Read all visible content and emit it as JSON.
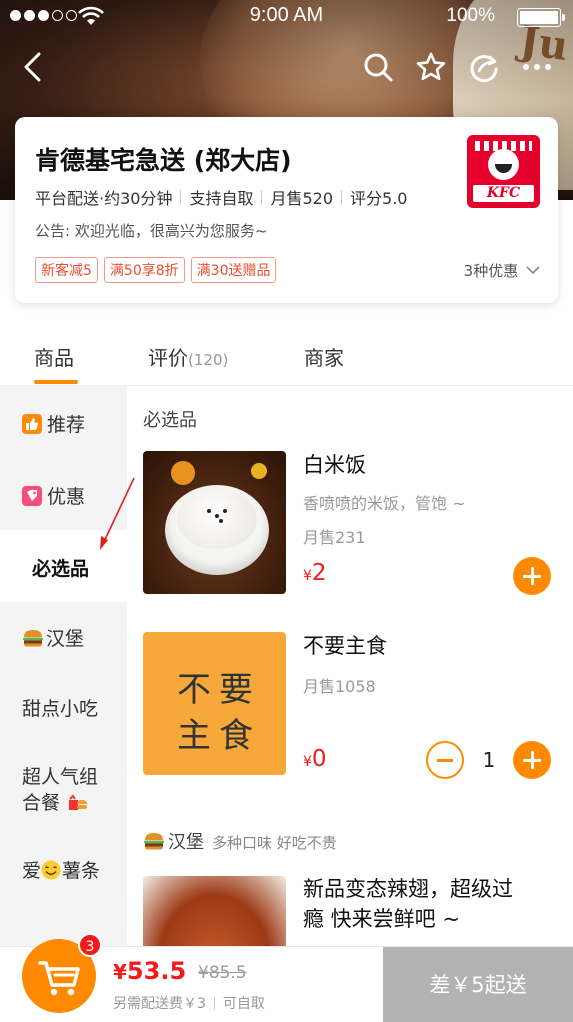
{
  "status_bar": {
    "time": "9:00 AM",
    "battery": "100%"
  },
  "nav": {
    "icons": [
      "back-icon",
      "search-icon",
      "star-icon",
      "share-icon",
      "more-icon"
    ]
  },
  "shop": {
    "name": "肯德基宅急送 (郑大店)",
    "meta": [
      "平台配送·约30分钟",
      "支持自取",
      "月售520",
      "评分5.0"
    ],
    "notice": "公告: 欢迎光临，很高兴为您服务~",
    "promos": [
      "新客减5",
      "满50享8折",
      "满30送赠品"
    ],
    "promo_more": "3种优惠",
    "logo_text": "KFC"
  },
  "tabs": [
    {
      "label": "商品",
      "count": ""
    },
    {
      "label": "评价",
      "count": "(120)"
    },
    {
      "label": "商家",
      "count": ""
    }
  ],
  "categories": [
    {
      "label": "推荐"
    },
    {
      "label": "优惠"
    },
    {
      "label": "必选品"
    },
    {
      "label": "汉堡"
    },
    {
      "label": "甜点小吃"
    },
    {
      "label_line1": "超人气组",
      "label_line2": "合餐"
    },
    {
      "label_pre": "爱",
      "label_post": "薯条"
    }
  ],
  "sections": {
    "required": {
      "title": "必选品"
    },
    "burger": {
      "title": "汉堡",
      "subtitle": "多种口味 好吃不贵"
    }
  },
  "goods": [
    {
      "name": "白米饭",
      "desc": "香喷喷的米饭，管饱 ~",
      "sales": "月售231",
      "currency": "¥",
      "price": "2"
    },
    {
      "name": "不要主食",
      "sales": "月售1058",
      "currency": "¥",
      "price": "0",
      "quantity": "1",
      "image_text_1": "不要",
      "image_text_2": "主食"
    },
    {
      "name_line1": "新品变态辣翅，超级过",
      "name_line2": "瘾 快来尝鲜吧 ~"
    }
  ],
  "cart": {
    "badge": "3",
    "currency": "¥",
    "total": "53.5",
    "original": "¥85.5",
    "fee": "另需配送费￥3",
    "pickup": "可自取",
    "submit": "差￥5起送"
  },
  "colors": {
    "accent": "#ff8a00",
    "price": "#f21b1b",
    "promo_border": "#f29a8a",
    "submit_disabled": "#b3b3b3"
  }
}
